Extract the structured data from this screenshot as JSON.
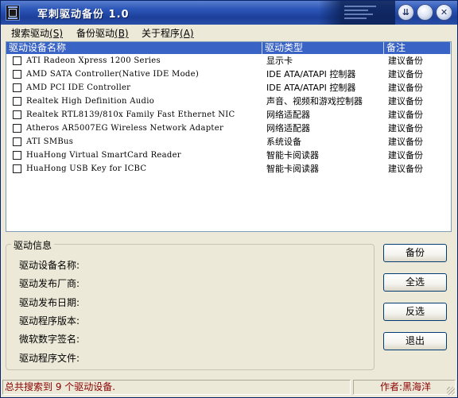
{
  "window": {
    "title": "军刺驱动备份 1.0",
    "controls": {
      "rollup": "⇊",
      "minimize": "",
      "close": "✕"
    }
  },
  "menu": [
    {
      "label": "搜索驱动",
      "key": "(S)"
    },
    {
      "label": "备份驱动",
      "key": "(B)"
    },
    {
      "label": "关于程序",
      "key": "(A)"
    }
  ],
  "table": {
    "columns": [
      "驱动设备名称",
      "驱动类型",
      "备注"
    ],
    "rows": [
      {
        "name": "ATI Radeon Xpress 1200 Series",
        "type": "显示卡",
        "note": "建议备份"
      },
      {
        "name": "AMD SATA Controller(Native IDE Mode)",
        "type": "IDE ATA/ATAPI 控制器",
        "note": "建议备份"
      },
      {
        "name": "AMD PCI IDE Controller",
        "type": "IDE ATA/ATAPI 控制器",
        "note": "建议备份"
      },
      {
        "name": "Realtek High Definition Audio",
        "type": "声音、视频和游戏控制器",
        "note": "建议备份"
      },
      {
        "name": "Realtek RTL8139/810x Family Fast Ethernet NIC",
        "type": "网络适配器",
        "note": "建议备份"
      },
      {
        "name": "Atheros AR5007EG Wireless Network Adapter",
        "type": "网络适配器",
        "note": "建议备份"
      },
      {
        "name": "ATI SMBus",
        "type": "系统设备",
        "note": "建议备份"
      },
      {
        "name": "HuaHong Virtual SmartCard Reader",
        "type": "智能卡阅读器",
        "note": "建议备份"
      },
      {
        "name": "HuaHong USB Key for ICBC",
        "type": "智能卡阅读器",
        "note": "建议备份"
      }
    ]
  },
  "info": {
    "title": "驱动信息",
    "labels": [
      "驱动设备名称:",
      "驱动发布厂商:",
      "驱动发布日期:",
      "驱动程序版本:",
      "微软数字签名:",
      "驱动程序文件:"
    ]
  },
  "buttons": {
    "backup": "备份",
    "select_all": "全选",
    "invert": "反选",
    "exit": "退出"
  },
  "status": {
    "left": "总共搜索到 9 个驱动设备.",
    "right": "作者:黑海洋"
  },
  "colors": {
    "header_bg": "#3a63c6",
    "status_text": "#8b0000"
  }
}
